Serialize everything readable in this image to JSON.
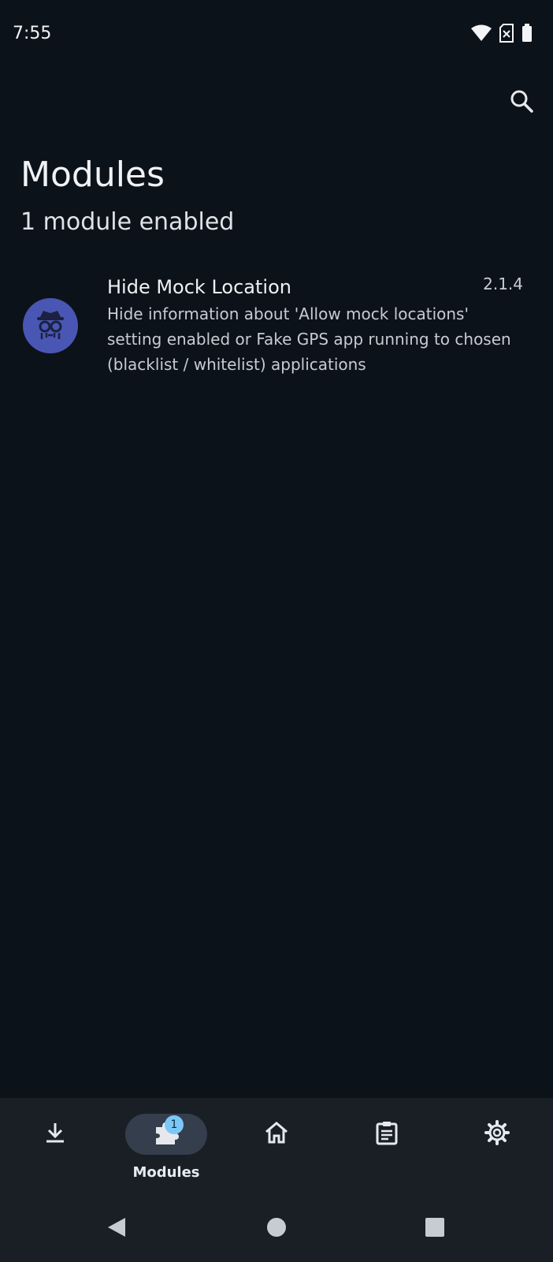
{
  "status_bar": {
    "time": "7:55",
    "icons": [
      "wifi-icon",
      "sim-off-icon",
      "battery-icon"
    ]
  },
  "top_bar": {
    "search_icon": "search-icon"
  },
  "page": {
    "title": "Modules",
    "subtitle": "1 module enabled"
  },
  "modules": [
    {
      "name": "Hide Mock Location",
      "version": "2.1.4",
      "description": "Hide information about 'Allow mock locations' setting enabled or Fake GPS app running to chosen (blacklist / whitelist) applications",
      "icon": "spy-icon"
    }
  ],
  "bottom_nav": {
    "items": [
      {
        "id": "repository",
        "icon": "download-icon",
        "label": ""
      },
      {
        "id": "modules",
        "icon": "puzzle-icon",
        "label": "Modules",
        "badge": "1",
        "active": true
      },
      {
        "id": "home",
        "icon": "home-icon",
        "label": ""
      },
      {
        "id": "logs",
        "icon": "clipboard-icon",
        "label": ""
      },
      {
        "id": "settings",
        "icon": "gear-icon",
        "label": ""
      }
    ]
  },
  "system_nav": [
    "back-icon",
    "home-circle-icon",
    "recents-icon"
  ],
  "colors": {
    "background": "#0c121a",
    "nav_background": "#1a1f26",
    "active_pill": "#343e4c",
    "badge": "#7cc7f7",
    "module_avatar": "#4a56b3"
  }
}
